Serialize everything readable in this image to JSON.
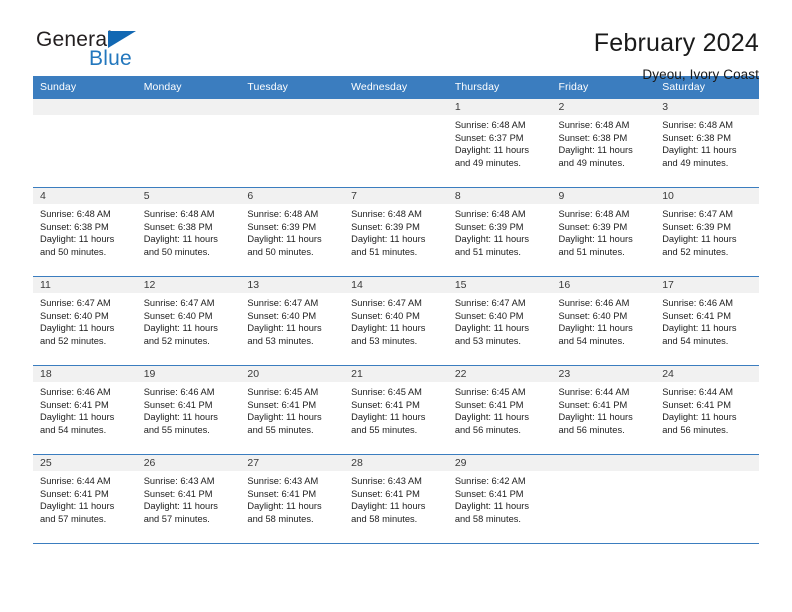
{
  "brand": {
    "name_part1": "General",
    "name_part2": "Blue",
    "flag_icon": "triangle-flag-icon"
  },
  "header": {
    "title": "February 2024",
    "subtitle": "Dyeou, Ivory Coast"
  },
  "colors": {
    "header_blue": "#3b7dbf",
    "brand_blue": "#2377bd",
    "date_band": "#f1f1f1",
    "text": "#1a1a1a"
  },
  "calendar": {
    "weekday_headers": [
      "Sunday",
      "Monday",
      "Tuesday",
      "Wednesday",
      "Thursday",
      "Friday",
      "Saturday"
    ],
    "weeks": [
      [
        {
          "date": "",
          "lines": []
        },
        {
          "date": "",
          "lines": []
        },
        {
          "date": "",
          "lines": []
        },
        {
          "date": "",
          "lines": []
        },
        {
          "date": "1",
          "lines": [
            "Sunrise: 6:48 AM",
            "Sunset: 6:37 PM",
            "Daylight: 11 hours",
            "and 49 minutes."
          ]
        },
        {
          "date": "2",
          "lines": [
            "Sunrise: 6:48 AM",
            "Sunset: 6:38 PM",
            "Daylight: 11 hours",
            "and 49 minutes."
          ]
        },
        {
          "date": "3",
          "lines": [
            "Sunrise: 6:48 AM",
            "Sunset: 6:38 PM",
            "Daylight: 11 hours",
            "and 49 minutes."
          ]
        }
      ],
      [
        {
          "date": "4",
          "lines": [
            "Sunrise: 6:48 AM",
            "Sunset: 6:38 PM",
            "Daylight: 11 hours",
            "and 50 minutes."
          ]
        },
        {
          "date": "5",
          "lines": [
            "Sunrise: 6:48 AM",
            "Sunset: 6:38 PM",
            "Daylight: 11 hours",
            "and 50 minutes."
          ]
        },
        {
          "date": "6",
          "lines": [
            "Sunrise: 6:48 AM",
            "Sunset: 6:39 PM",
            "Daylight: 11 hours",
            "and 50 minutes."
          ]
        },
        {
          "date": "7",
          "lines": [
            "Sunrise: 6:48 AM",
            "Sunset: 6:39 PM",
            "Daylight: 11 hours",
            "and 51 minutes."
          ]
        },
        {
          "date": "8",
          "lines": [
            "Sunrise: 6:48 AM",
            "Sunset: 6:39 PM",
            "Daylight: 11 hours",
            "and 51 minutes."
          ]
        },
        {
          "date": "9",
          "lines": [
            "Sunrise: 6:48 AM",
            "Sunset: 6:39 PM",
            "Daylight: 11 hours",
            "and 51 minutes."
          ]
        },
        {
          "date": "10",
          "lines": [
            "Sunrise: 6:47 AM",
            "Sunset: 6:39 PM",
            "Daylight: 11 hours",
            "and 52 minutes."
          ]
        }
      ],
      [
        {
          "date": "11",
          "lines": [
            "Sunrise: 6:47 AM",
            "Sunset: 6:40 PM",
            "Daylight: 11 hours",
            "and 52 minutes."
          ]
        },
        {
          "date": "12",
          "lines": [
            "Sunrise: 6:47 AM",
            "Sunset: 6:40 PM",
            "Daylight: 11 hours",
            "and 52 minutes."
          ]
        },
        {
          "date": "13",
          "lines": [
            "Sunrise: 6:47 AM",
            "Sunset: 6:40 PM",
            "Daylight: 11 hours",
            "and 53 minutes."
          ]
        },
        {
          "date": "14",
          "lines": [
            "Sunrise: 6:47 AM",
            "Sunset: 6:40 PM",
            "Daylight: 11 hours",
            "and 53 minutes."
          ]
        },
        {
          "date": "15",
          "lines": [
            "Sunrise: 6:47 AM",
            "Sunset: 6:40 PM",
            "Daylight: 11 hours",
            "and 53 minutes."
          ]
        },
        {
          "date": "16",
          "lines": [
            "Sunrise: 6:46 AM",
            "Sunset: 6:40 PM",
            "Daylight: 11 hours",
            "and 54 minutes."
          ]
        },
        {
          "date": "17",
          "lines": [
            "Sunrise: 6:46 AM",
            "Sunset: 6:41 PM",
            "Daylight: 11 hours",
            "and 54 minutes."
          ]
        }
      ],
      [
        {
          "date": "18",
          "lines": [
            "Sunrise: 6:46 AM",
            "Sunset: 6:41 PM",
            "Daylight: 11 hours",
            "and 54 minutes."
          ]
        },
        {
          "date": "19",
          "lines": [
            "Sunrise: 6:46 AM",
            "Sunset: 6:41 PM",
            "Daylight: 11 hours",
            "and 55 minutes."
          ]
        },
        {
          "date": "20",
          "lines": [
            "Sunrise: 6:45 AM",
            "Sunset: 6:41 PM",
            "Daylight: 11 hours",
            "and 55 minutes."
          ]
        },
        {
          "date": "21",
          "lines": [
            "Sunrise: 6:45 AM",
            "Sunset: 6:41 PM",
            "Daylight: 11 hours",
            "and 55 minutes."
          ]
        },
        {
          "date": "22",
          "lines": [
            "Sunrise: 6:45 AM",
            "Sunset: 6:41 PM",
            "Daylight: 11 hours",
            "and 56 minutes."
          ]
        },
        {
          "date": "23",
          "lines": [
            "Sunrise: 6:44 AM",
            "Sunset: 6:41 PM",
            "Daylight: 11 hours",
            "and 56 minutes."
          ]
        },
        {
          "date": "24",
          "lines": [
            "Sunrise: 6:44 AM",
            "Sunset: 6:41 PM",
            "Daylight: 11 hours",
            "and 56 minutes."
          ]
        }
      ],
      [
        {
          "date": "25",
          "lines": [
            "Sunrise: 6:44 AM",
            "Sunset: 6:41 PM",
            "Daylight: 11 hours",
            "and 57 minutes."
          ]
        },
        {
          "date": "26",
          "lines": [
            "Sunrise: 6:43 AM",
            "Sunset: 6:41 PM",
            "Daylight: 11 hours",
            "and 57 minutes."
          ]
        },
        {
          "date": "27",
          "lines": [
            "Sunrise: 6:43 AM",
            "Sunset: 6:41 PM",
            "Daylight: 11 hours",
            "and 58 minutes."
          ]
        },
        {
          "date": "28",
          "lines": [
            "Sunrise: 6:43 AM",
            "Sunset: 6:41 PM",
            "Daylight: 11 hours",
            "and 58 minutes."
          ]
        },
        {
          "date": "29",
          "lines": [
            "Sunrise: 6:42 AM",
            "Sunset: 6:41 PM",
            "Daylight: 11 hours",
            "and 58 minutes."
          ]
        },
        {
          "date": "",
          "lines": []
        },
        {
          "date": "",
          "lines": []
        }
      ]
    ]
  }
}
